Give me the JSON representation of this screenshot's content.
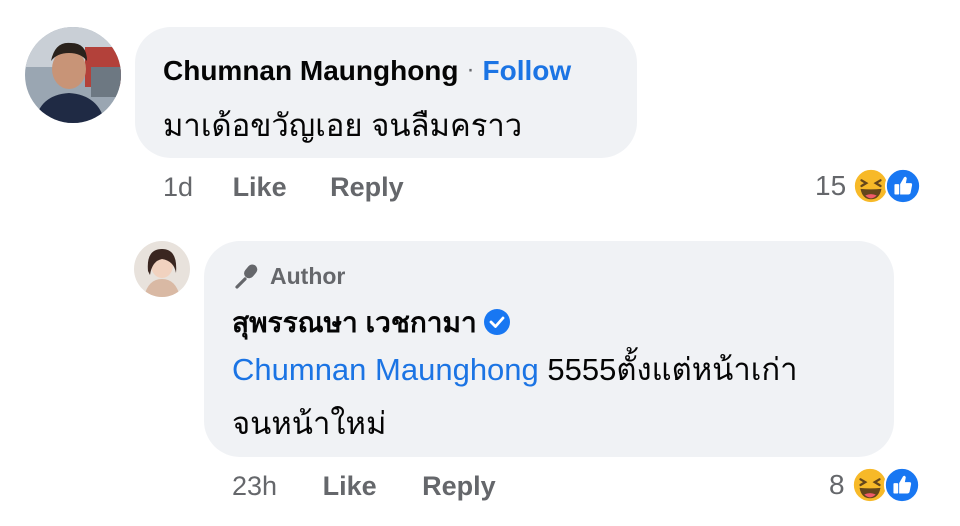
{
  "comment": {
    "author_name": "Chumnan Maunghong",
    "separator": "·",
    "follow_label": "Follow",
    "text": "มาเด้อขวัญเอย จนลืมคราว",
    "time": "1d",
    "like_label": "Like",
    "reply_label": "Reply",
    "reaction_count": "15",
    "reaction_icons": [
      "haha-icon",
      "like-icon"
    ]
  },
  "reply": {
    "badge_label": "Author",
    "author_name": "สุพรรณษา เวชกามา",
    "verified": true,
    "mention": "Chumnan Maunghong",
    "text_line1": " 5555ตั้งแต่หน้าเก่า",
    "text_line2": "จนหน้าใหม่",
    "time": "23h",
    "like_label": "Like",
    "reply_label": "Reply",
    "reaction_count": "8",
    "reaction_icons": [
      "haha-icon",
      "like-icon"
    ]
  },
  "colors": {
    "bubble": "#f0f2f5",
    "link_blue": "#1b74e4",
    "secondary_text": "#65676b",
    "haha_yellow": "#f7b928",
    "like_blue": "#1877f2"
  }
}
